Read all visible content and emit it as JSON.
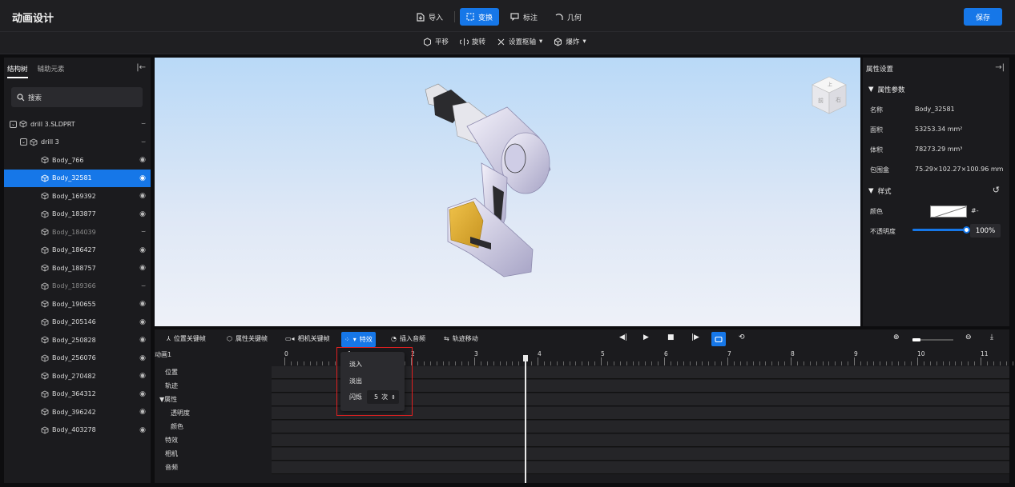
{
  "app": {
    "title": "动画设计",
    "save_label": "保存"
  },
  "top_tabs": [
    {
      "label": "导入",
      "icon": "import-icon"
    },
    {
      "label": "变换",
      "icon": "transform-icon",
      "active": true
    },
    {
      "label": "标注",
      "icon": "annotation-icon"
    },
    {
      "label": "几何",
      "icon": "geometry-icon"
    }
  ],
  "sub_toolbar": [
    {
      "label": "平移",
      "icon": "move-icon"
    },
    {
      "label": "旋转",
      "icon": "rotate-icon"
    },
    {
      "label": "设置枢轴",
      "icon": "pivot-icon",
      "dropdown": true
    },
    {
      "label": "爆炸",
      "icon": "explode-icon",
      "dropdown": true
    }
  ],
  "left_panel": {
    "tabs": [
      "结构树",
      "辅助元素"
    ],
    "search_placeholder": "搜索",
    "tree": [
      {
        "label": "drill 3.SLDPRT",
        "level": 0,
        "hidden": true
      },
      {
        "label": "drill 3",
        "level": 1,
        "hidden": true
      },
      {
        "label": "Body_766",
        "level": 2
      },
      {
        "label": "Body_32581",
        "level": 2,
        "selected": true
      },
      {
        "label": "Body_169392",
        "level": 2
      },
      {
        "label": "Body_183877",
        "level": 2
      },
      {
        "label": "Body_184039",
        "level": 2,
        "hidden": true
      },
      {
        "label": "Body_186427",
        "level": 2
      },
      {
        "label": "Body_188757",
        "level": 2
      },
      {
        "label": "Body_189366",
        "level": 2,
        "hidden": true
      },
      {
        "label": "Body_190655",
        "level": 2
      },
      {
        "label": "Body_205146",
        "level": 2
      },
      {
        "label": "Body_250828",
        "level": 2
      },
      {
        "label": "Body_256076",
        "level": 2
      },
      {
        "label": "Body_270482",
        "level": 2
      },
      {
        "label": "Body_364312",
        "level": 2
      },
      {
        "label": "Body_396242",
        "level": 2
      },
      {
        "label": "Body_403278",
        "level": 2
      }
    ]
  },
  "view_cube": {
    "top": "上",
    "front": "前",
    "right": "右"
  },
  "right_panel": {
    "title": "属性设置",
    "section_props": "属性参数",
    "props": [
      {
        "label": "名称",
        "value": "Body_32581"
      },
      {
        "label": "面积",
        "value": "53253.34 mm²"
      },
      {
        "label": "体积",
        "value": "78273.29 mm³"
      },
      {
        "label": "包围盒",
        "value": "75.29×102.27×100.96 mm"
      }
    ],
    "section_style": "样式",
    "color_label": "颜色",
    "color_value": "#-",
    "opacity_label": "不透明度",
    "opacity_value": "100%",
    "opacity_level": 1.0
  },
  "timeline": {
    "tools": [
      "位置关键帧",
      "属性关键帧",
      "相机关键帧",
      "特效",
      "插入音频",
      "轨迹移动"
    ],
    "clip_name": "动画1",
    "tracks": [
      "位置",
      "轨迹",
      "属性",
      "透明度",
      "颜色",
      "特效",
      "相机",
      "音频"
    ],
    "ruler": [
      "0",
      "1",
      "2",
      "3",
      "4",
      "5",
      "6",
      "7",
      "8",
      "9",
      "10",
      "11"
    ],
    "playhead_time": 3.8
  },
  "effects_popup": {
    "items": [
      "淡入",
      "淡出"
    ],
    "blink_label": "闪烁",
    "blink_count": "5",
    "blink_unit": "次"
  },
  "colors": {
    "accent": "#1677e8",
    "highlight": "#e02020"
  }
}
